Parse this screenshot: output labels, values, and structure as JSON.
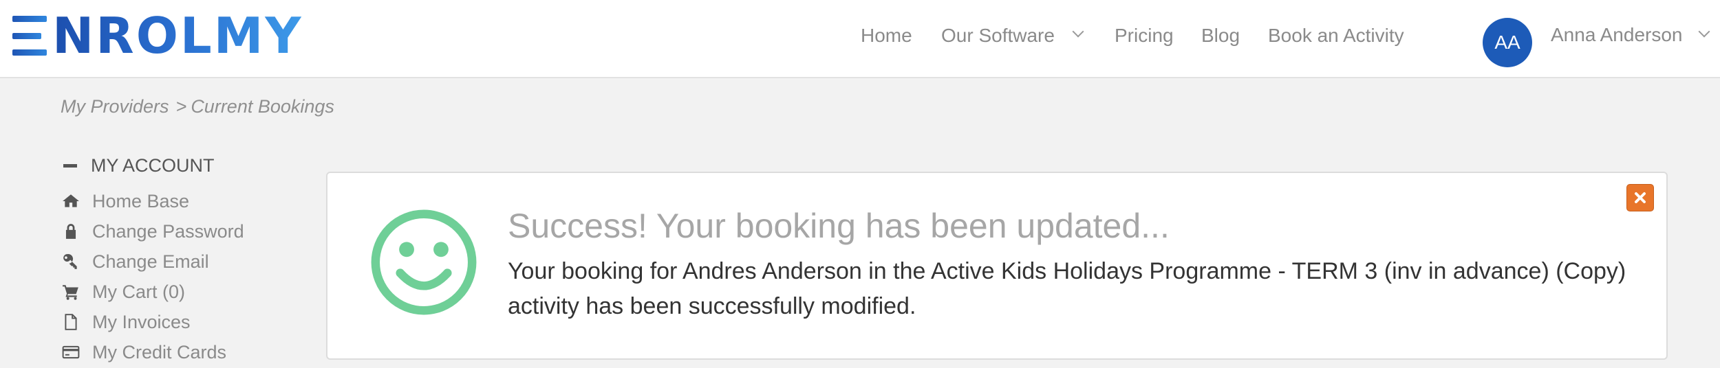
{
  "brand": {
    "logo_text": "NROLMY",
    "logo_mark": "E"
  },
  "nav": {
    "items": [
      {
        "label": "Home"
      },
      {
        "label": "Our Software"
      },
      {
        "label": "Pricing"
      },
      {
        "label": "Blog"
      },
      {
        "label": "Book an Activity"
      }
    ]
  },
  "user": {
    "initials": "AA",
    "name": "Anna Anderson"
  },
  "breadcrumb": {
    "items": [
      "My Providers",
      "Current Bookings"
    ],
    "separator": ">"
  },
  "sidebar": {
    "title": "MY ACCOUNT",
    "items": [
      {
        "label": "Home Base",
        "icon": "home-icon"
      },
      {
        "label": "Change Password",
        "icon": "lock-icon"
      },
      {
        "label": "Change Email",
        "icon": "key-icon"
      },
      {
        "label": "My Cart (0)",
        "icon": "cart-icon"
      },
      {
        "label": "My Invoices",
        "icon": "document-icon"
      },
      {
        "label": "My Credit Cards",
        "icon": "credit-card-icon"
      }
    ]
  },
  "alert": {
    "title": "Success! Your booking has been updated...",
    "message": "Your booking for Andres Anderson in the Active Kids Holidays Programme - TERM 3 (inv in advance) (Copy) activity has been successfully modified.",
    "icon": "smiley-icon",
    "close_icon": "close-icon",
    "colors": {
      "smiley": "#6fcf97",
      "close": "#e8752a"
    }
  },
  "colors": {
    "brand_blue": "#1d5bb8",
    "background": "#f2f2f2"
  }
}
